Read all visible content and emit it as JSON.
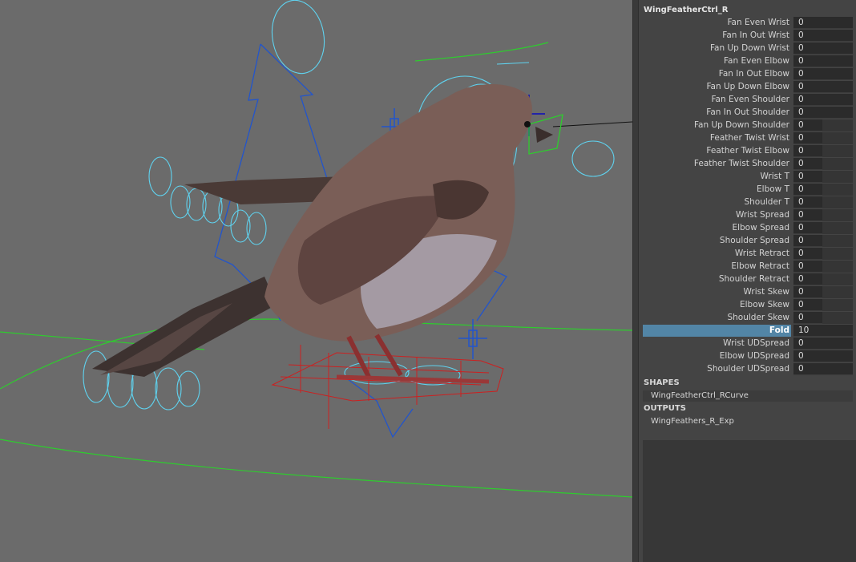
{
  "channel_box": {
    "node_name": "WingFeatherCtrl_R",
    "attributes": [
      {
        "label": "Fan Even Wrist",
        "value": "0"
      },
      {
        "label": "Fan In Out Wrist",
        "value": "0"
      },
      {
        "label": "Fan Up Down Wrist",
        "value": "0"
      },
      {
        "label": "Fan Even Elbow",
        "value": "0"
      },
      {
        "label": "Fan In Out Elbow",
        "value": "0"
      },
      {
        "label": "Fan Up Down Elbow",
        "value": "0"
      },
      {
        "label": "Fan Even Shoulder",
        "value": "0"
      },
      {
        "label": "Fan In Out Shoulder",
        "value": "0"
      },
      {
        "label": "Fan Up Down Shoulder",
        "value": "0"
      },
      {
        "label": "Feather Twist Wrist",
        "value": "0"
      },
      {
        "label": "Feather Twist Elbow",
        "value": "0"
      },
      {
        "label": "Feather Twist Shoulder",
        "value": "0"
      },
      {
        "label": "Wrist T",
        "value": "0"
      },
      {
        "label": "Elbow T",
        "value": "0"
      },
      {
        "label": "Shoulder T",
        "value": "0"
      },
      {
        "label": "Wrist Spread",
        "value": "0"
      },
      {
        "label": "Elbow Spread",
        "value": "0"
      },
      {
        "label": "Shoulder Spread",
        "value": "0"
      },
      {
        "label": "Wrist Retract",
        "value": "0"
      },
      {
        "label": "Elbow Retract",
        "value": "0"
      },
      {
        "label": "Shoulder Retract",
        "value": "0"
      },
      {
        "label": "Wrist Skew",
        "value": "0"
      },
      {
        "label": "Elbow Skew",
        "value": "0"
      },
      {
        "label": "Shoulder Skew",
        "value": "0"
      },
      {
        "label": "Fold",
        "value": "10"
      },
      {
        "label": "Wrist UDSpread",
        "value": "0"
      },
      {
        "label": "Elbow UDSpread",
        "value": "0"
      },
      {
        "label": "Shoulder UDSpread",
        "value": "0"
      }
    ],
    "selected_attribute": "Fold",
    "shapes_header": "SHAPES",
    "shapes_item": "WingFeatherCtrl_RCurve",
    "outputs_header": "OUTPUTS",
    "outputs_item": "WingFeathers_R_Exp"
  },
  "colors": {
    "viewport_bg": "#6b6b6b",
    "control_curve": "#5fd3f0",
    "nurbs_curve": "#2ecc2e",
    "locator": "#2255cc",
    "joint": "#cc2020",
    "selection": "#5285a6"
  }
}
